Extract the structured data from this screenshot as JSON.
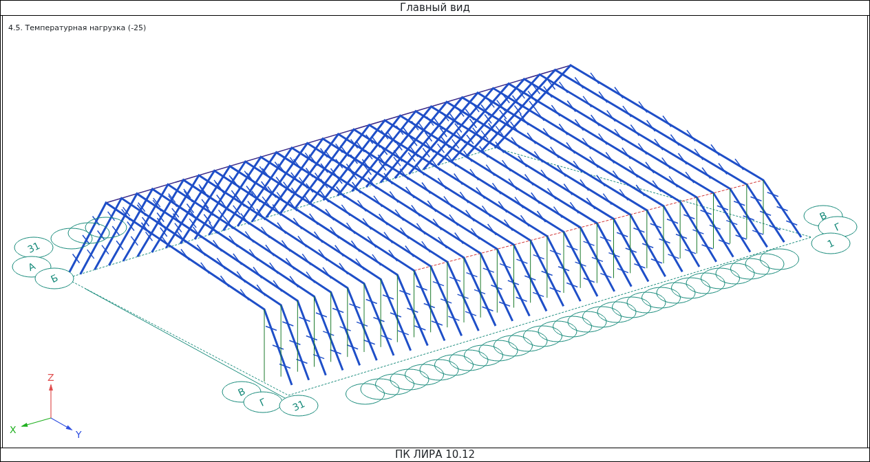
{
  "window": {
    "title": "Главный вид"
  },
  "viewport": {
    "load_case": "4.5. Температурная нагрузка (-25)",
    "axis_markers": [
      {
        "label": "31"
      },
      {
        "label": "А"
      },
      {
        "label": "Б"
      },
      {
        "label": "В"
      },
      {
        "label": "Г"
      },
      {
        "label": "31"
      },
      {
        "label": "В"
      },
      {
        "label": "Г"
      },
      {
        "label": "1"
      }
    ],
    "triad": {
      "z": "Z",
      "x": "X",
      "y": "Y"
    }
  },
  "status_bar": {
    "text": "ПК ЛИРА 10.12"
  }
}
